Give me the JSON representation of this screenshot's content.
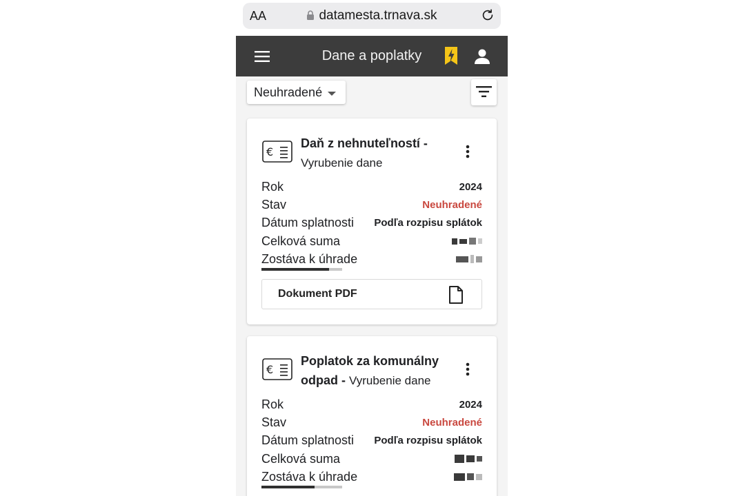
{
  "browser": {
    "text_size_label": "AA",
    "url": "datamesta.trnava.sk"
  },
  "appbar": {
    "title": "Dane a poplatky"
  },
  "filter": {
    "selected": "Neuhradené"
  },
  "labels": {
    "year": "Rok",
    "status": "Stav",
    "due_date": "Dátum splatnosti",
    "total": "Celková suma",
    "remaining": "Zostáva k úhrade"
  },
  "cards": [
    {
      "title_bold": "Daň z nehnuteľností -",
      "title_rest": "Vyrubenie dane",
      "year": "2024",
      "status": "Neuhradené",
      "due_date": "Podľa rozpisu splátok",
      "total": "",
      "remaining": "",
      "paid_fraction": 0.84,
      "pdf_label": "Dokument PDF"
    },
    {
      "title_bold": "Poplatok za komunálny odpad -",
      "title_rest": "Vyrubenie dane",
      "year": "2024",
      "status": "Neuhradené",
      "due_date": "Podľa rozpisu splátok",
      "total": "",
      "remaining": "",
      "paid_fraction": 0.66
    }
  ],
  "colors": {
    "appbar": "#3c3c3c",
    "status_unpaid": "#c9483f",
    "bolt": "#f5c518"
  },
  "icons": [
    "text-size-icon",
    "lock-icon",
    "reload-icon",
    "menu-icon",
    "bolt-bookmark-icon",
    "user-icon",
    "filter-icon",
    "euro-invoice-icon",
    "more-vert-icon",
    "document-icon"
  ]
}
